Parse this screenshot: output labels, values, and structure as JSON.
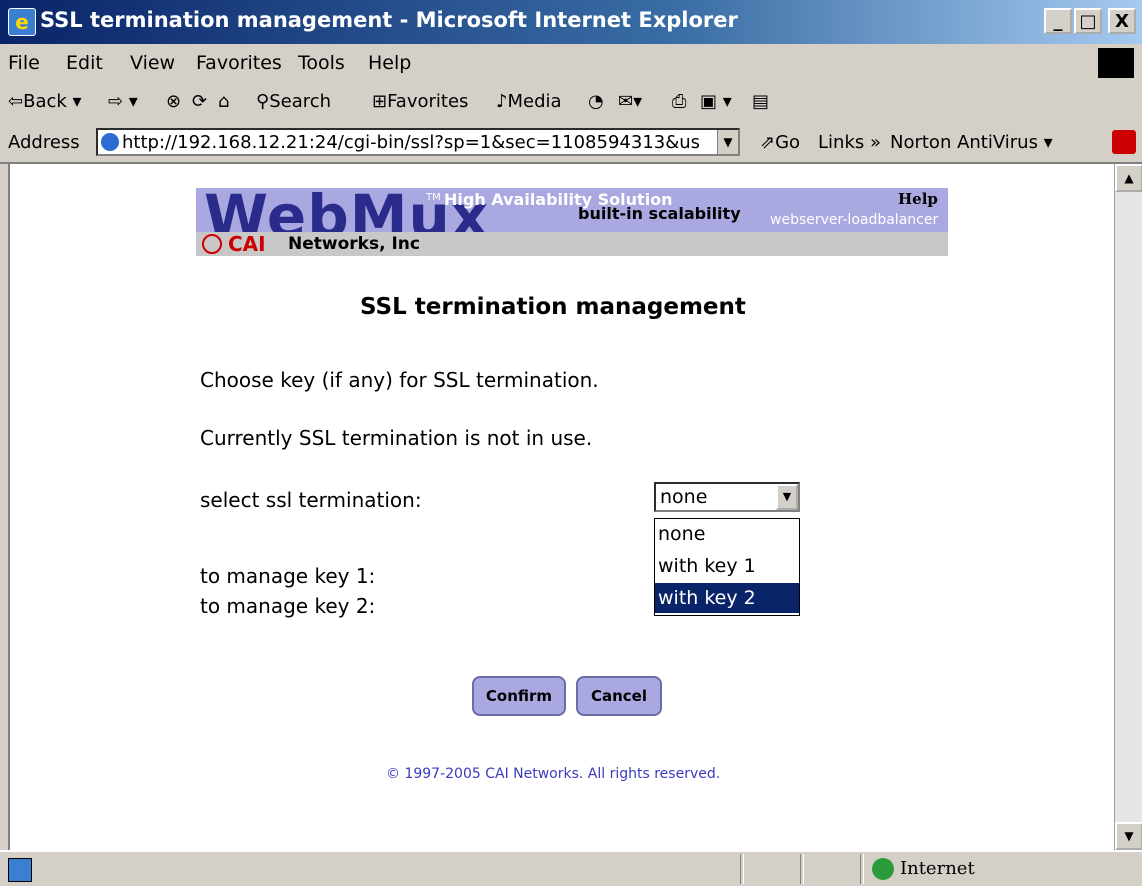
{
  "window": {
    "title": "SSL termination management - Microsoft Internet Explorer",
    "minimize": "_",
    "maximize": "□",
    "close": "X"
  },
  "menu": [
    "File",
    "Edit",
    "View",
    "Favorites",
    "Tools",
    "Help"
  ],
  "toolbar": {
    "back": "Back ▾",
    "forward": "⇨ ▾",
    "stop": "⊗",
    "refresh": "⟳",
    "home": "⌂",
    "search": "Search",
    "favorites": "Favorites",
    "media": "Media",
    "history": "◔",
    "mail": "✉▾",
    "print": "⎙",
    "edit": "▣ ▾",
    "discuss": "▤"
  },
  "address": {
    "label": "Address",
    "url": "http://192.168.12.21:24/cgi-bin/ssl?sp=1&sec=1108594313&us",
    "go": "Go",
    "links": "Links »",
    "norton": "Norton AntiVirus ▾"
  },
  "banner": {
    "logo": "WebMux",
    "tm": "TM",
    "tagline1": "High Availability Solution",
    "tagline2": "built-in scalability",
    "tagline3": "webserver-loadbalancer",
    "help": "Help",
    "company_cai": "CAI",
    "company_rest": "Networks, Inc"
  },
  "page": {
    "heading": "SSL termination management",
    "choose_text": "Choose key (if any) for SSL termination.",
    "status_text": "Currently SSL termination is not in use.",
    "select_label": "select ssl termination:",
    "select_value": "none",
    "options": [
      "none",
      "with key 1",
      "with key 2"
    ],
    "highlighted_option": "with key 2",
    "manage_key1": "to manage key 1:",
    "manage_key2": "to manage key 2:",
    "confirm": "Confirm",
    "cancel": "Cancel",
    "footer": "© 1997-2005 CAI Networks. All rights reserved."
  },
  "status": {
    "zone": "Internet"
  },
  "colors": {
    "titlebar": "#0a246a",
    "banner": "#a9a8e0",
    "highlight": "#0a246a",
    "footer_link": "#3b3bbf",
    "cai_red": "#cc0000"
  }
}
